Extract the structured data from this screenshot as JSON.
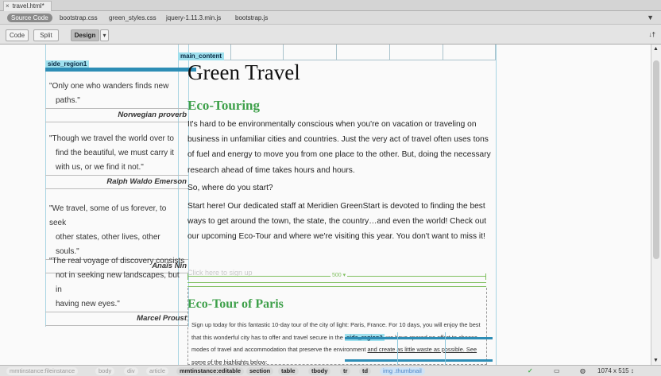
{
  "document_tab": {
    "close": "×",
    "title": "travel.html*"
  },
  "files": [
    "Source Code",
    "bootstrap.css",
    "green_styles.css",
    "jquery-1.11.3.min.js",
    "bootstrap.js"
  ],
  "toolbar": {
    "code": "Code",
    "split": "Split",
    "design": "Design",
    "design_menu": "▾",
    "filter_icon": "filter-icon",
    "sort_icon": "sort-icon"
  },
  "labels": {
    "side_region1": "side_region1",
    "main_content": "main_content"
  },
  "quotes": [
    {
      "line1": "\"Only one who wanders finds new",
      "line2": "paths.\"",
      "author": "Norwegian proverb"
    },
    {
      "line1": "\"Though we travel the world over to",
      "line2": "find the beautiful, we must carry it",
      "line3": "with us, or we find it not.\"",
      "author": "Ralph Waldo Emerson"
    },
    {
      "line1": "\"We travel, some of us forever, to seek",
      "line2": "other states, other lives, other souls.\"",
      "author": "Anaïs Nin"
    },
    {
      "line1": "\"The real voyage of discovery consists",
      "line2": "not in seeking new landscapes, but in",
      "line3": "having new eyes.\"",
      "author": "Marcel Proust"
    }
  ],
  "main": {
    "title": "Green Travel",
    "subtitle": "Eco-Touring",
    "para1": "It's hard to be environmentally conscious when you're on vacation or traveling on business in unfamiliar cities and countries. Just the very act of travel often uses tons of fuel and energy to move you from one place to the other. But, doing the necessary research ahead of time takes hours and hours.",
    "para2": "So, where do you start?",
    "para3": "Start here! Our dedicated staff at Meridien GreenStart is devoted to finding the best ways to get around the town, the state, the country…and even the world! Check out our upcoming Eco-Tour and where we're visiting this year. You don't want to miss it!",
    "click_here": "Click here to sign up",
    "measure_label": "500 ▾",
    "paris_title": "Eco-Tour of Paris",
    "paris_a": "Sign up today for this fantastic 10-day tour of the city of light: Paris, France. For 10 days, you will enjoy the best that this wonderful city has to offer and travel secure in the",
    "paris_tag": "side_region2",
    "paris_b": "we have spared no effort to choose modes of travel and accommodation that preserve the environment",
    "paris_c": "and create as little waste as possible. See",
    "paris_d": "some of the highlights below:"
  },
  "status": {
    "crumbs": [
      "mmtinstance:fileinstance",
      "body",
      "div",
      "article",
      "mmtinstance:editable",
      "section",
      "table",
      "tbody",
      "tr",
      "td",
      "img .thumbnail"
    ],
    "check": "✓",
    "size": "1074 x 515 ↕"
  }
}
